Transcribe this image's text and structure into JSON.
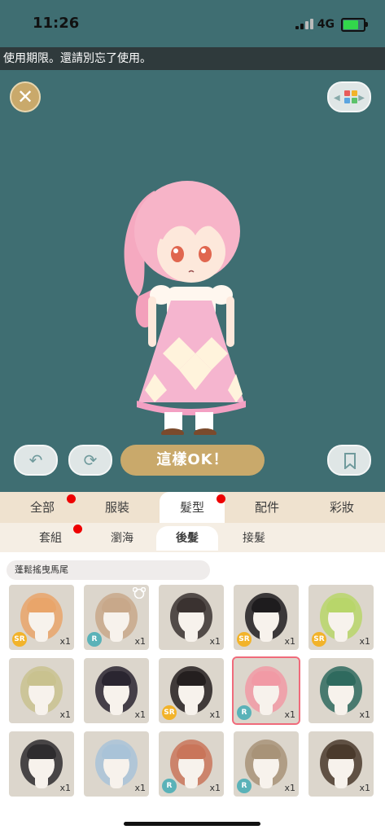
{
  "status_bar": {
    "time": "11:26",
    "network": "4G"
  },
  "ticker": {
    "text": "使用期限。還請別忘了使用。"
  },
  "stage": {
    "confirm_label": "這樣OK！",
    "background": "#3f6e72",
    "accent": "#c9a96b",
    "icons": {
      "close": "close-icon",
      "palette": "palette-icon",
      "undo": "undo-icon",
      "refresh": "refresh-icon",
      "bookmark": "bookmark-icon"
    }
  },
  "categories": [
    {
      "label": "全部",
      "has_dot": true
    },
    {
      "label": "服裝",
      "has_dot": false
    },
    {
      "label": "髮型",
      "has_dot": true,
      "active": true
    },
    {
      "label": "配件",
      "has_dot": false
    },
    {
      "label": "彩妝",
      "has_dot": false
    }
  ],
  "subcategories": [
    {
      "label": "套組",
      "has_dot": true
    },
    {
      "label": "瀏海",
      "has_dot": false
    },
    {
      "label": "後髮",
      "has_dot": false,
      "active": true
    },
    {
      "label": "接髮",
      "has_dot": false
    }
  ],
  "selected_item_title": "蓬鬆搖曳馬尾",
  "items": [
    {
      "qty": "x1",
      "rarity": "SR",
      "hair": "#e9a56a",
      "bear": false
    },
    {
      "qty": "x1",
      "rarity": "R",
      "hair": "#c8a88a",
      "bear": true
    },
    {
      "qty": "x1",
      "rarity": "",
      "hair": "#3a3230",
      "bear": false
    },
    {
      "qty": "x1",
      "rarity": "SR",
      "hair": "#1e1c1e",
      "bear": false
    },
    {
      "qty": "x1",
      "rarity": "SR",
      "hair": "#b8d66a",
      "bear": false
    },
    {
      "qty": "x1",
      "rarity": "",
      "hair": "#c9c28f",
      "bear": false
    },
    {
      "qty": "x1",
      "rarity": "",
      "hair": "#2a2530",
      "bear": false
    },
    {
      "qty": "x1",
      "rarity": "SR",
      "hair": "#241f1f",
      "bear": false
    },
    {
      "qty": "x1",
      "rarity": "R",
      "hair": "#f19aa5",
      "bear": false,
      "selected": true
    },
    {
      "qty": "x1",
      "rarity": "",
      "hair": "#2f6a5e",
      "bear": false
    },
    {
      "qty": "x1",
      "rarity": "",
      "hair": "#2e2c2e",
      "bear": false
    },
    {
      "qty": "x1",
      "rarity": "",
      "hair": "#a9c3d8",
      "bear": false
    },
    {
      "qty": "x1",
      "rarity": "R",
      "hair": "#c9755a",
      "bear": false
    },
    {
      "qty": "x1",
      "rarity": "R",
      "hair": "#a89378",
      "bear": false
    },
    {
      "qty": "x1",
      "rarity": "",
      "hair": "#4a3a2c",
      "bear": false
    }
  ]
}
